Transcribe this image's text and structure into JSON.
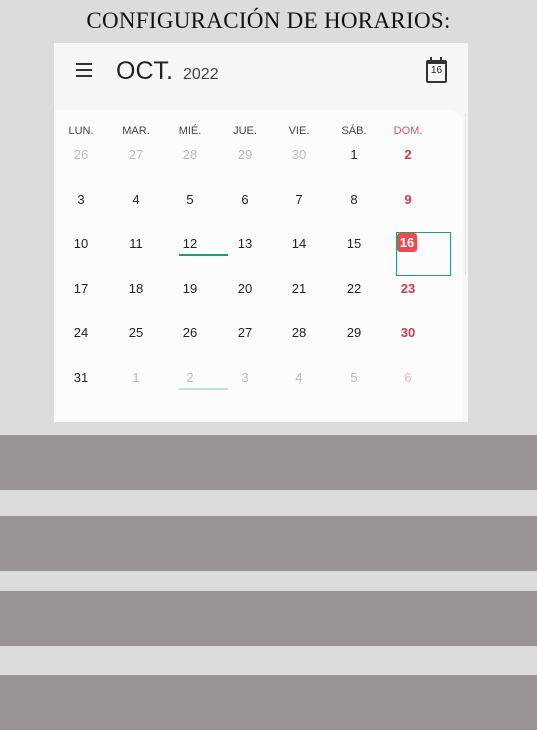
{
  "heading": "CONFIGURACIÓN DE HORARIOS:",
  "calendar": {
    "month": "OCT.",
    "year": "2022",
    "today_icon_day": "16",
    "weekdays": [
      "LUN.",
      "MAR.",
      "MIÉ.",
      "JUE.",
      "VIE.",
      "SÁB.",
      "DOM."
    ],
    "weeks": [
      [
        "26",
        "27",
        "28",
        "29",
        "30",
        "1",
        "2"
      ],
      [
        "3",
        "4",
        "5",
        "6",
        "7",
        "8",
        "9"
      ],
      [
        "10",
        "11",
        "12",
        "13",
        "14",
        "15",
        "16"
      ],
      [
        "17",
        "18",
        "19",
        "20",
        "21",
        "22",
        "23"
      ],
      [
        "24",
        "25",
        "26",
        "27",
        "28",
        "29",
        "30"
      ],
      [
        "31",
        "1",
        "2",
        "3",
        "4",
        "5",
        "6"
      ]
    ],
    "today": "16"
  },
  "colors": {
    "accent_green": "#2a9a75",
    "sunday_red": "#d2384c",
    "today_badge": "#ea4b53"
  },
  "icons": [
    "menu-icon",
    "calendar-today-icon"
  ]
}
